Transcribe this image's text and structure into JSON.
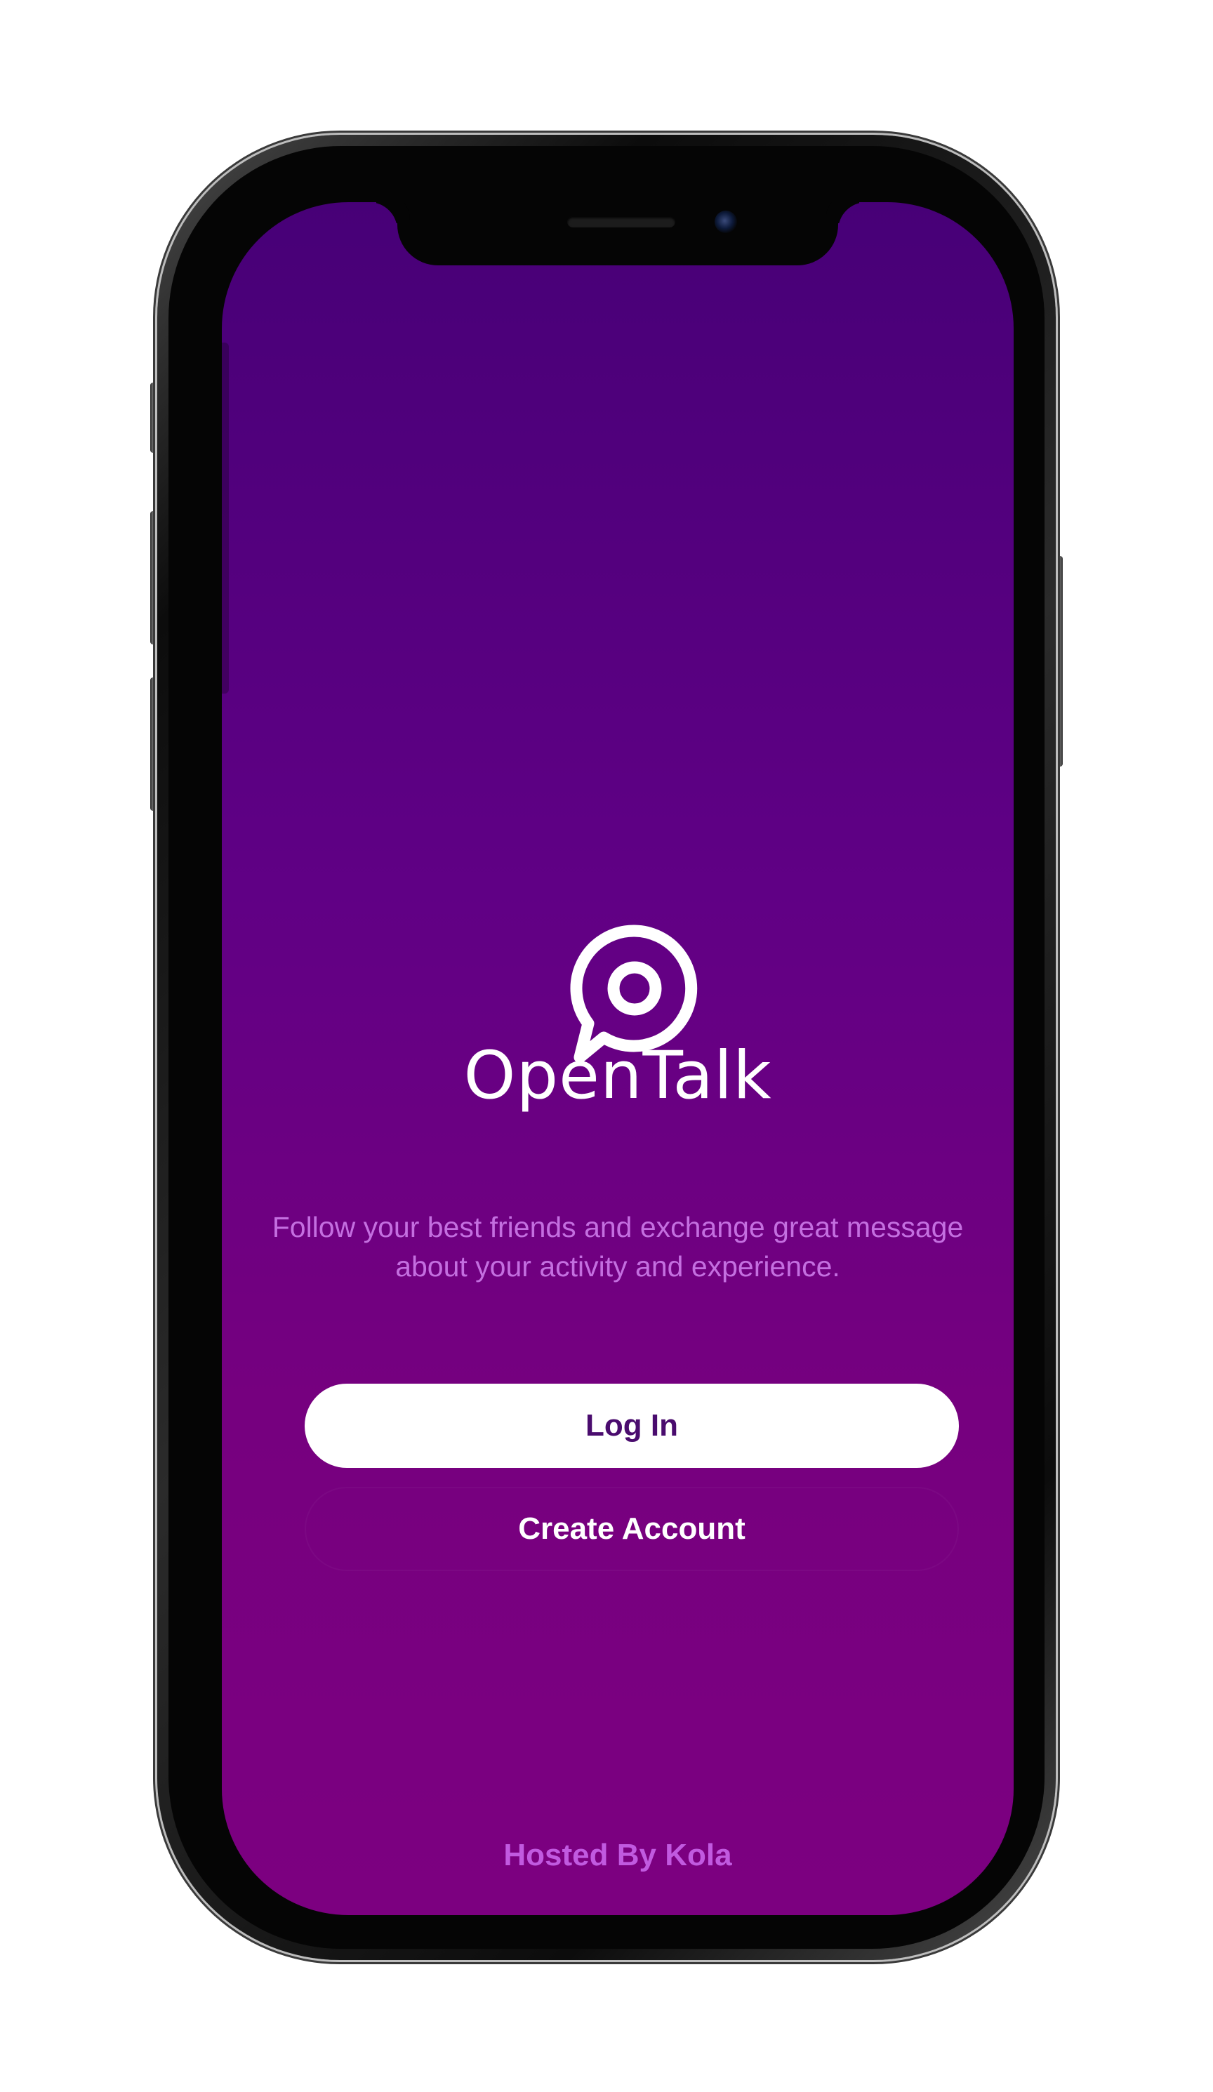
{
  "app": {
    "title": "OpenTalk",
    "tagline": "Follow your best friends and exchange great message about your activity and experience.",
    "footer": "Hosted By Kola"
  },
  "actions": {
    "login_label": "Log In",
    "create_account_label": "Create Account"
  },
  "icons": {
    "logo": "chat-bubble-target-icon",
    "speaker": "earpiece-speaker",
    "camera": "front-camera"
  },
  "colors": {
    "gradient_top": "#470077",
    "gradient_bottom": "#7c0080",
    "login_text": "#4a0c6e",
    "tagline": "#c46fe0",
    "footer": "#c15ae0"
  }
}
